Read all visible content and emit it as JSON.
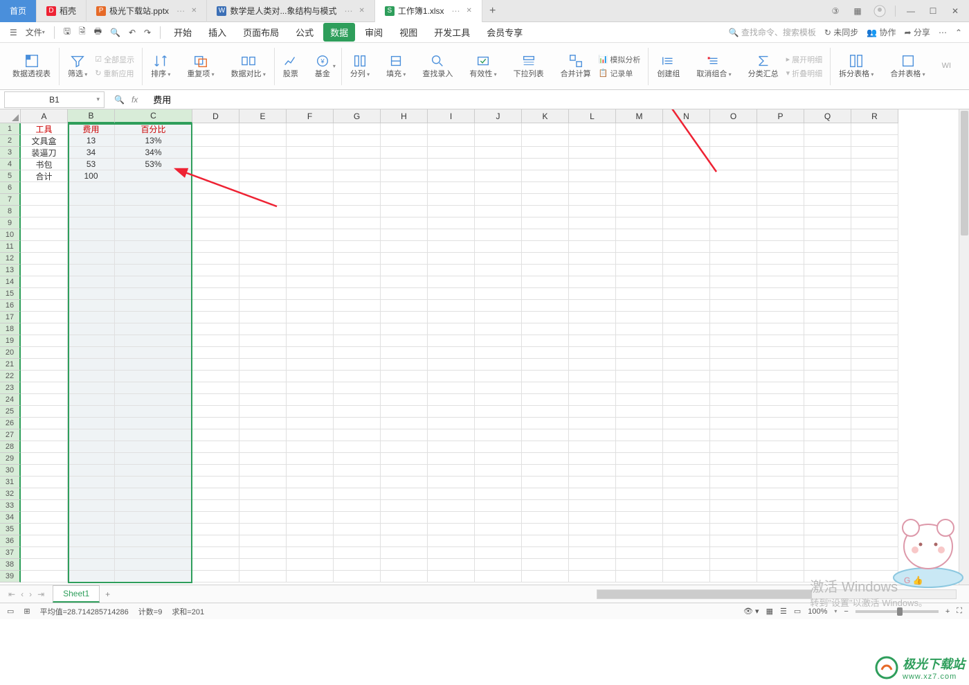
{
  "tabs": {
    "home": "首页",
    "t1": "稻壳",
    "t2": "极光下载站.pptx",
    "t3": "数学是人类对...象结构与模式",
    "t4": "工作簿1.xlsx"
  },
  "qat": {
    "file": "文件"
  },
  "menu": {
    "start": "开始",
    "insert": "插入",
    "layout": "页面布局",
    "formula": "公式",
    "data": "数据",
    "review": "审阅",
    "view": "视图",
    "devtools": "开发工具",
    "member": "会员专享"
  },
  "menu_right": {
    "search": "查找命令、搜索模板",
    "unsync": "未同步",
    "collab": "协作",
    "share": "分享"
  },
  "ribbon": {
    "pivot": "数据透视表",
    "filter": "筛选",
    "show_all": "全部显示",
    "reapply": "重新应用",
    "sort": "排序",
    "dedup": "重复项",
    "compare": "数据对比",
    "stock": "股票",
    "fund": "基金",
    "split": "分列",
    "fill": "填充",
    "lookup": "查找录入",
    "validation": "有效性",
    "dropdown": "下拉列表",
    "consolidate": "合并计算",
    "whatif": "模拟分析",
    "record": "记录单",
    "group": "创建组",
    "ungroup": "取消组合",
    "subtotal": "分类汇总",
    "expand": "展开明细",
    "collapse": "折叠明细",
    "splittable": "拆分表格",
    "mergetable": "合并表格",
    "wps": "WI"
  },
  "namebox": "B1",
  "formula": "费用",
  "columns": [
    "A",
    "B",
    "C",
    "D",
    "E",
    "F",
    "G",
    "H",
    "I",
    "J",
    "K",
    "L",
    "M",
    "N",
    "O",
    "P",
    "Q",
    "R"
  ],
  "sel_cols": [
    "B",
    "C"
  ],
  "table": {
    "headers": {
      "a": "工具",
      "b": "费用",
      "c": "百分比"
    },
    "rows": [
      {
        "a": "文具盒",
        "b": "13",
        "c": "13%"
      },
      {
        "a": "装逼刀",
        "b": "34",
        "c": "34%"
      },
      {
        "a": "书包",
        "b": "53",
        "c": "53%"
      },
      {
        "a": "合计",
        "b": "100",
        "c": ""
      }
    ]
  },
  "sheet": {
    "name": "Sheet1"
  },
  "status": {
    "avg": "平均值=28.714285714286",
    "count": "计数=9",
    "sum": "求和=201",
    "zoom": "100%"
  },
  "watermark": {
    "l1": "激活 Windows",
    "l2": "转到\"设置\"以激活 Windows。",
    "brand": "极光下载站",
    "brand_url": "www.xz7.com"
  }
}
